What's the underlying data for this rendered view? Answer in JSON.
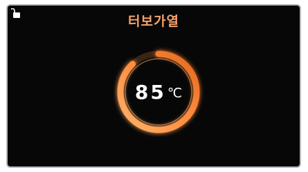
{
  "header": {
    "title": "터보가열",
    "lock_icon": "padlock-open-icon"
  },
  "dial": {
    "temperature_value": "85",
    "temperature_unit": "℃",
    "ring_progress": 0.88,
    "accent_color": "#ff8a3d",
    "title_color": "#f7a36d"
  }
}
